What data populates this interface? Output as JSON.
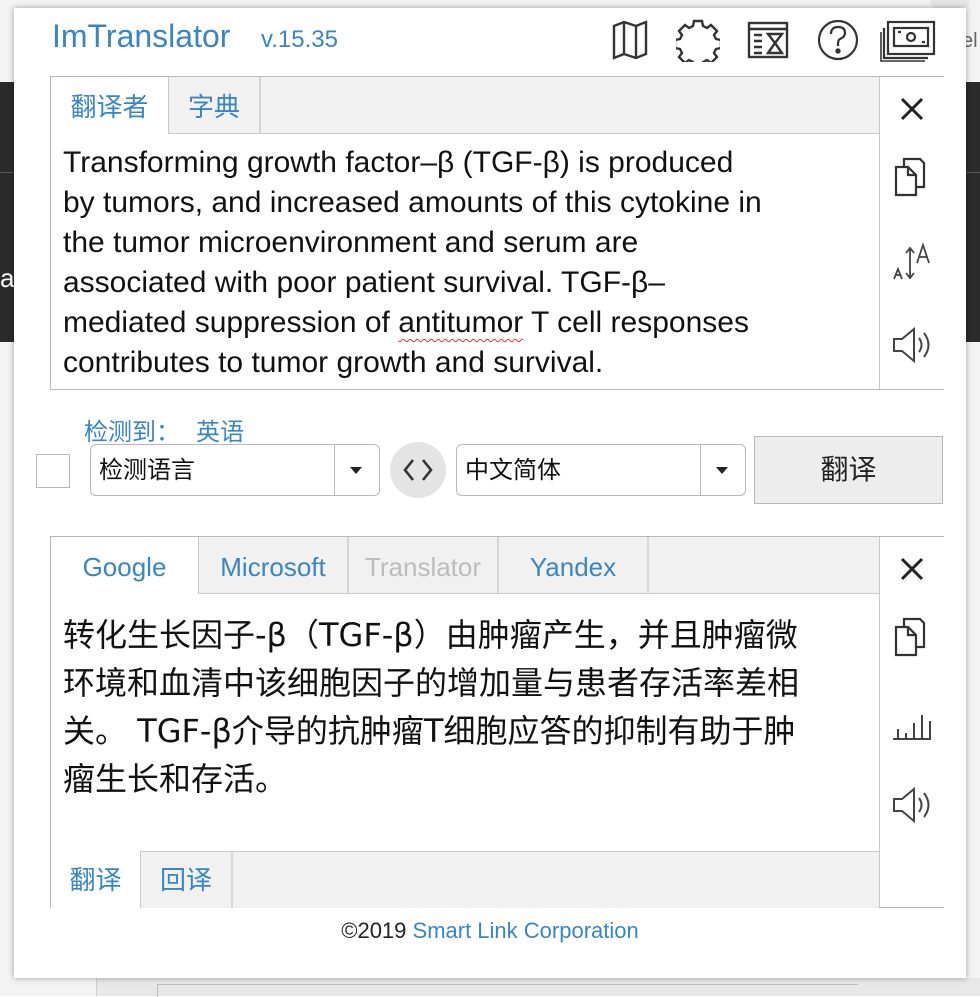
{
  "header": {
    "title": "ImTranslator",
    "version": "v.15.35",
    "icons": [
      "map-icon",
      "settings-gear-icon",
      "history-icon",
      "help-icon",
      "window-icon"
    ]
  },
  "source": {
    "tabs": [
      {
        "label": "翻译者",
        "active": true
      },
      {
        "label": "字典",
        "active": false
      }
    ],
    "text_lines": [
      "Transforming growth factor–β (TGF-β) is produced",
      "by tumors, and increased amounts of this cytokine in",
      "the tumor microenvironment and serum are",
      "associated with poor patient survival. TGF-β–"
    ],
    "text_line5_pre": "mediated suppression of ",
    "text_line5_spell": "antitumor",
    "text_line5_post": " T cell responses",
    "text_line6": "contributes to tumor growth and survival.",
    "side_icons": [
      "close-icon",
      "copy-icon",
      "font-size-icon",
      "speaker-icon"
    ]
  },
  "detected": {
    "label": "检测到：",
    "language": "英语"
  },
  "controls": {
    "source_lang": "检测语言",
    "target_lang": "中文简体",
    "translate_button": "翻译"
  },
  "result": {
    "tabs": [
      {
        "label": "Google",
        "active": true,
        "disabled": false
      },
      {
        "label": "Microsoft",
        "active": false,
        "disabled": false
      },
      {
        "label": "Translator",
        "active": false,
        "disabled": true
      },
      {
        "label": "Yandex",
        "active": false,
        "disabled": false
      }
    ],
    "text_lines": [
      "转化生长因子-β（TGF-β）由肿瘤产生，并且肿瘤微",
      "环境和血清中该细胞因子的增加量与患者存活率差相",
      "关。 TGF-β介导的抗肿瘤T细胞应答的抑制有助于肿",
      "瘤生长和存活。"
    ],
    "bottom_tabs": [
      {
        "label": "翻译",
        "active": true
      },
      {
        "label": "回译",
        "active": false
      }
    ],
    "side_icons": [
      "close-icon",
      "copy-icon",
      "chart-icon",
      "speaker-icon"
    ]
  },
  "footer": {
    "copyright": "©2019 ",
    "link_text": "Smart Link Corporation"
  },
  "colors": {
    "accent": "#3a86c2",
    "border": "#b8b8b8",
    "tab_bg": "#f1f1f1",
    "spellcheck": "#e03030"
  }
}
